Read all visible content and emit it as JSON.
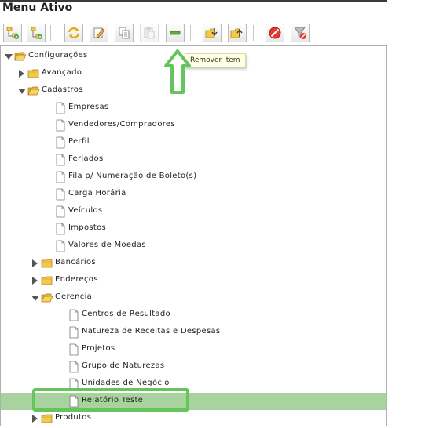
{
  "window": {
    "title": "Menu Ativo"
  },
  "colors": {
    "selected_row": "#a9d39e",
    "highlight": "#66c45d",
    "folder": "#f2c94c"
  },
  "toolbar": {
    "buttons": [
      {
        "name": "add-root-button",
        "icon": "tree-add-icon"
      },
      {
        "name": "add-child-button",
        "icon": "tree-add-child-icon"
      },
      {
        "name": "refresh-button",
        "icon": "refresh-icon"
      },
      {
        "name": "edit-button",
        "icon": "edit-icon"
      },
      {
        "name": "copy-button",
        "icon": "copy-icon"
      },
      {
        "name": "paste-button",
        "icon": "paste-icon"
      },
      {
        "name": "remove-item-button",
        "icon": "minus-icon"
      },
      {
        "name": "move-down-button",
        "icon": "folder-down-icon"
      },
      {
        "name": "move-up-button",
        "icon": "folder-up-icon"
      },
      {
        "name": "cancel-button",
        "icon": "stop-icon"
      },
      {
        "name": "clear-filter-button",
        "icon": "funnel-clear-icon"
      }
    ],
    "tooltip": "Remover Item"
  },
  "tree": [
    {
      "label": "Configurações",
      "depth": 0,
      "type": "folder",
      "state": "expanded"
    },
    {
      "label": "Avançado",
      "depth": 1,
      "type": "folder",
      "state": "collapsed"
    },
    {
      "label": "Cadastros",
      "depth": 1,
      "type": "folder",
      "state": "expanded"
    },
    {
      "label": "Empresas",
      "depth": 2,
      "type": "file"
    },
    {
      "label": "Vendedores/Compradores",
      "depth": 2,
      "type": "file"
    },
    {
      "label": "Perfil",
      "depth": 2,
      "type": "file"
    },
    {
      "label": "Feriados",
      "depth": 2,
      "type": "file"
    },
    {
      "label": "Fila p/ Numeração de Boleto(s)",
      "depth": 2,
      "type": "file"
    },
    {
      "label": "Carga Horária",
      "depth": 2,
      "type": "file"
    },
    {
      "label": "Veículos",
      "depth": 2,
      "type": "file"
    },
    {
      "label": "Impostos",
      "depth": 2,
      "type": "file"
    },
    {
      "label": "Valores de Moedas",
      "depth": 2,
      "type": "file"
    },
    {
      "label": "Bancários",
      "depth": 2,
      "type": "folder",
      "state": "collapsed"
    },
    {
      "label": "Endereços",
      "depth": 2,
      "type": "folder",
      "state": "collapsed"
    },
    {
      "label": "Gerencial",
      "depth": 2,
      "type": "folder",
      "state": "expanded"
    },
    {
      "label": "Centros de Resultado",
      "depth": 3,
      "type": "file"
    },
    {
      "label": "Natureza de Receitas e Despesas",
      "depth": 3,
      "type": "file"
    },
    {
      "label": "Projetos",
      "depth": 3,
      "type": "file"
    },
    {
      "label": "Grupo de Naturezas",
      "depth": 3,
      "type": "file"
    },
    {
      "label": "Unidades de Negócio",
      "depth": 3,
      "type": "file"
    },
    {
      "label": "Relatório Teste",
      "depth": 3,
      "type": "file",
      "selected": true
    },
    {
      "label": "Produtos",
      "depth": 2,
      "type": "folder",
      "state": "collapsed"
    }
  ]
}
